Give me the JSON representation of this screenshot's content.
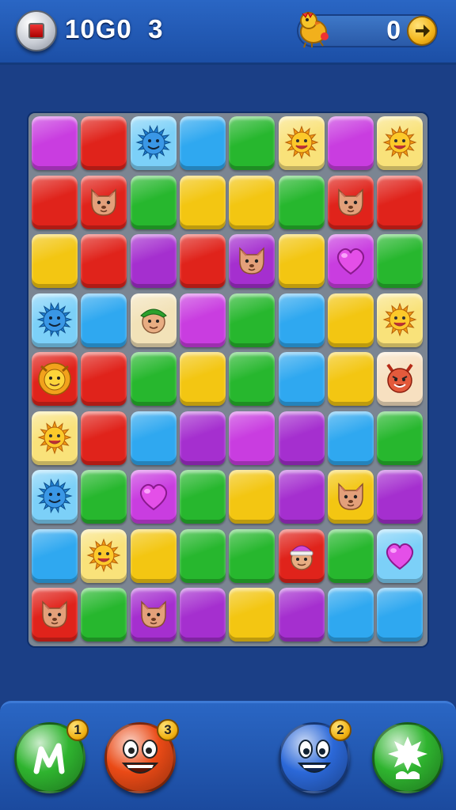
{
  "header": {
    "title": "10G0  3",
    "score": "0"
  },
  "colors": {
    "M": "#c93de0",
    "R": "#e0231b",
    "B": "#2fa8f0",
    "G": "#27b72e",
    "Y": "#f3c612",
    "P": "#a52fcf"
  },
  "board": {
    "rows": [
      [
        {
          "c": "M"
        },
        {
          "c": "R"
        },
        {
          "c": "B",
          "i": "spiky"
        },
        {
          "c": "B"
        },
        {
          "c": "G"
        },
        {
          "c": "Y",
          "i": "sun"
        },
        {
          "c": "M"
        },
        {
          "c": "Y",
          "i": "sun"
        }
      ],
      [
        {
          "c": "R"
        },
        {
          "c": "R",
          "i": "cat"
        },
        {
          "c": "G"
        },
        {
          "c": "Y"
        },
        {
          "c": "Y"
        },
        {
          "c": "G"
        },
        {
          "c": "R",
          "i": "cat"
        },
        {
          "c": "R"
        }
      ],
      [
        {
          "c": "Y"
        },
        {
          "c": "R"
        },
        {
          "c": "P"
        },
        {
          "c": "R"
        },
        {
          "c": "P",
          "i": "cat"
        },
        {
          "c": "Y"
        },
        {
          "c": "M",
          "i": "heart"
        },
        {
          "c": "G"
        }
      ],
      [
        {
          "c": "B",
          "i": "spiky"
        },
        {
          "c": "B"
        },
        {
          "c": "Y",
          "i": "elf"
        },
        {
          "c": "M"
        },
        {
          "c": "G"
        },
        {
          "c": "B"
        },
        {
          "c": "Y"
        },
        {
          "c": "Y",
          "i": "sun"
        }
      ],
      [
        {
          "c": "R",
          "i": "lion"
        },
        {
          "c": "R"
        },
        {
          "c": "G"
        },
        {
          "c": "Y"
        },
        {
          "c": "G"
        },
        {
          "c": "B"
        },
        {
          "c": "Y"
        },
        {
          "c": "Y",
          "i": "devil"
        }
      ],
      [
        {
          "c": "Y",
          "i": "sun"
        },
        {
          "c": "R"
        },
        {
          "c": "B"
        },
        {
          "c": "P"
        },
        {
          "c": "M"
        },
        {
          "c": "P"
        },
        {
          "c": "B"
        },
        {
          "c": "G"
        }
      ],
      [
        {
          "c": "B",
          "i": "spiky"
        },
        {
          "c": "G"
        },
        {
          "c": "M",
          "i": "heart"
        },
        {
          "c": "G"
        },
        {
          "c": "Y"
        },
        {
          "c": "P"
        },
        {
          "c": "Y",
          "i": "cat"
        },
        {
          "c": "P"
        }
      ],
      [
        {
          "c": "B"
        },
        {
          "c": "Y",
          "i": "sun"
        },
        {
          "c": "Y"
        },
        {
          "c": "G"
        },
        {
          "c": "G"
        },
        {
          "c": "R",
          "i": "hat"
        },
        {
          "c": "G"
        },
        {
          "c": "B",
          "i": "heart"
        }
      ],
      [
        {
          "c": "R",
          "i": "cat"
        },
        {
          "c": "G"
        },
        {
          "c": "P",
          "i": "cat"
        },
        {
          "c": "P"
        },
        {
          "c": "Y"
        },
        {
          "c": "P"
        },
        {
          "c": "B"
        },
        {
          "c": "B"
        }
      ]
    ]
  },
  "boosters": [
    {
      "name": "shuffle-booster",
      "icon": "shuffle-icon",
      "count": "1",
      "color": "#2fb42f"
    },
    {
      "name": "red-face-booster",
      "icon": "red-face-icon",
      "count": "3",
      "color": "#ea4a16"
    },
    {
      "name": "blue-face-booster",
      "icon": "blue-face-icon",
      "count": "2",
      "color": "#2b68d8"
    },
    {
      "name": "splash-booster",
      "icon": "splash-icon",
      "count": "",
      "color": "#2fb42f"
    }
  ]
}
